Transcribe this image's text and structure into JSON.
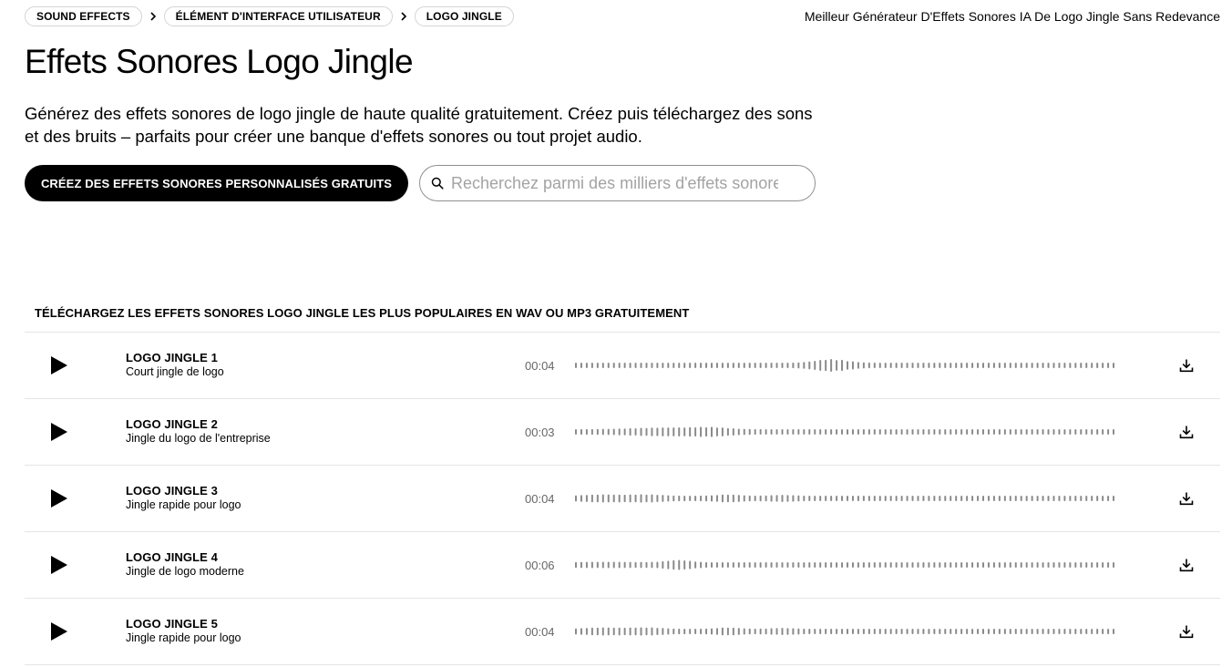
{
  "breadcrumb": {
    "items": [
      {
        "label": "SOUND EFFECTS"
      },
      {
        "label": "ÉLÉMENT D'INTERFACE UTILISATEUR"
      },
      {
        "label": "LOGO JINGLE"
      }
    ]
  },
  "header": {
    "tagline": "Meilleur Générateur D'Effets Sonores IA De Logo Jingle Sans Redevance"
  },
  "hero": {
    "title": "Effets Sonores Logo Jingle",
    "intro": "Générez des effets sonores de logo jingle de haute qualité gratuitement. Créez puis téléchargez des sons et des bruits – parfaits pour créer une banque d'effets sonores ou tout projet audio.",
    "cta_label": "CRÉEZ DES EFFETS SONORES PERSONNALISÉS GRATUITS"
  },
  "search": {
    "placeholder": "Recherchez parmi des milliers d'effets sonores",
    "value": ""
  },
  "list": {
    "heading": "TÉLÉCHARGEZ LES EFFETS SONORES LOGO JINGLE LES PLUS POPULAIRES EN WAV OU MP3 GRATUITEMENT",
    "items": [
      {
        "title": "LOGO JINGLE 1",
        "description": "Court jingle de logo",
        "duration": "00:04"
      },
      {
        "title": "LOGO JINGLE 2",
        "description": "Jingle du logo de l'entreprise",
        "duration": "00:03"
      },
      {
        "title": "LOGO JINGLE 3",
        "description": "Jingle rapide pour logo",
        "duration": "00:04"
      },
      {
        "title": "LOGO JINGLE 4",
        "description": "Jingle de logo moderne",
        "duration": "00:06"
      },
      {
        "title": "LOGO JINGLE 5",
        "description": "Jingle rapide pour logo",
        "duration": "00:04"
      }
    ]
  },
  "icons": {
    "breadcrumb_separator": "chevron-right-icon",
    "search": "search-icon",
    "play": "play-icon",
    "download": "download-icon"
  },
  "colors": {
    "text": "#000000",
    "muted": "#666666",
    "waveform": "#8a8a8a",
    "divider": "#e5e5e5",
    "cta_background": "#000000",
    "cta_text": "#ffffff"
  }
}
